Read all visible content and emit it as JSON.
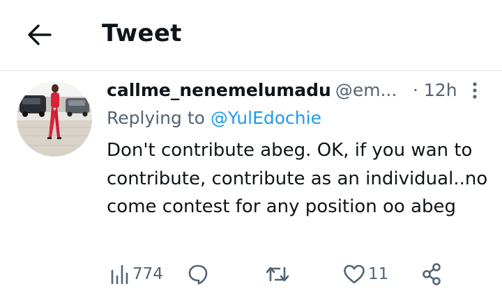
{
  "header": {
    "title": "Tweet",
    "back_icon": "arrow-left-icon"
  },
  "tweet": {
    "author_name": "callme_nenemelumadu",
    "author_handle": "@em...",
    "time": "· 12h",
    "replying_prefix": "Replying to ",
    "replying_to": "@YulEdochie",
    "text": "Don't contribute abeg. OK, if you wan to contribute, contribute as an individual..no come contest for any position oo abeg",
    "avatar_icon": "avatar"
  },
  "actions": {
    "views": {
      "icon": "views-chart-icon",
      "count": "774"
    },
    "reply": {
      "icon": "reply-bubble-icon"
    },
    "retweet": {
      "icon": "retweet-icon"
    },
    "like": {
      "icon": "heart-icon",
      "count": "11"
    },
    "share": {
      "icon": "share-icon"
    }
  },
  "colors": {
    "text": "#0f1419",
    "secondary": "#536471",
    "link": "#1d9bf0",
    "divider": "#e3e6e9"
  }
}
